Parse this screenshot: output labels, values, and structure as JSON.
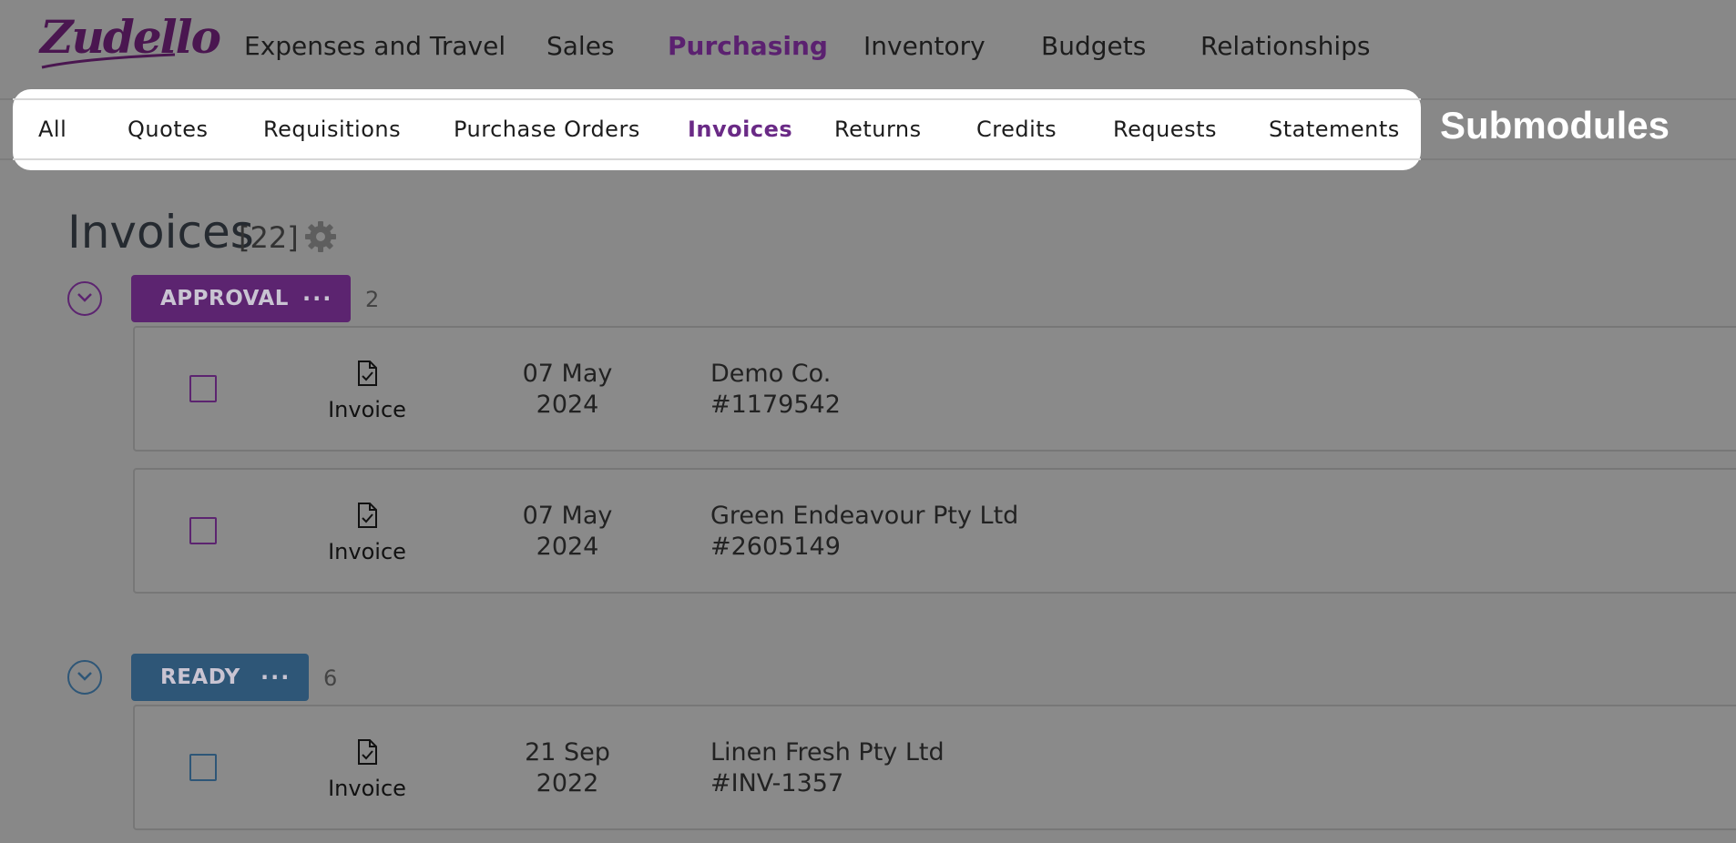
{
  "brand": {
    "logo_text": "Zudello",
    "logo_color": "#4a1650"
  },
  "main_nav": {
    "items": [
      {
        "label": "Expenses and Travel",
        "active": false
      },
      {
        "label": "Sales",
        "active": false
      },
      {
        "label": "Purchasing",
        "active": true
      },
      {
        "label": "Inventory",
        "active": false
      },
      {
        "label": "Budgets",
        "active": false
      },
      {
        "label": "Relationships",
        "active": false
      }
    ]
  },
  "submodules": {
    "callout_label": "Submodules",
    "tabs": [
      {
        "label": "All",
        "active": false
      },
      {
        "label": "Quotes",
        "active": false
      },
      {
        "label": "Requisitions",
        "active": false
      },
      {
        "label": "Purchase Orders",
        "active": false
      },
      {
        "label": "Invoices",
        "active": true
      },
      {
        "label": "Returns",
        "active": false
      },
      {
        "label": "Credits",
        "active": false
      },
      {
        "label": "Requests",
        "active": false
      },
      {
        "label": "Statements",
        "active": false
      }
    ]
  },
  "page": {
    "title": "Invoices",
    "count": "[22]",
    "settings_icon": "gear-icon"
  },
  "groups": [
    {
      "status": "APPROVAL",
      "menu": "···",
      "count": "2",
      "color": "#5c2470",
      "items": [
        {
          "type": "Invoice",
          "date_line1": "07 May",
          "date_line2": "2024",
          "party": "Demo Co.",
          "ref": "#1179542"
        },
        {
          "type": "Invoice",
          "date_line1": "07 May",
          "date_line2": "2024",
          "party": "Green Endeavour Pty Ltd",
          "ref": "#2605149"
        }
      ]
    },
    {
      "status": "READY",
      "menu": "···",
      "count": "6",
      "color": "#2e5677",
      "items": [
        {
          "type": "Invoice",
          "date_line1": "21 Sep",
          "date_line2": "2022",
          "party": "Linen Fresh Pty Ltd",
          "ref": "#INV-1357"
        }
      ]
    }
  ]
}
